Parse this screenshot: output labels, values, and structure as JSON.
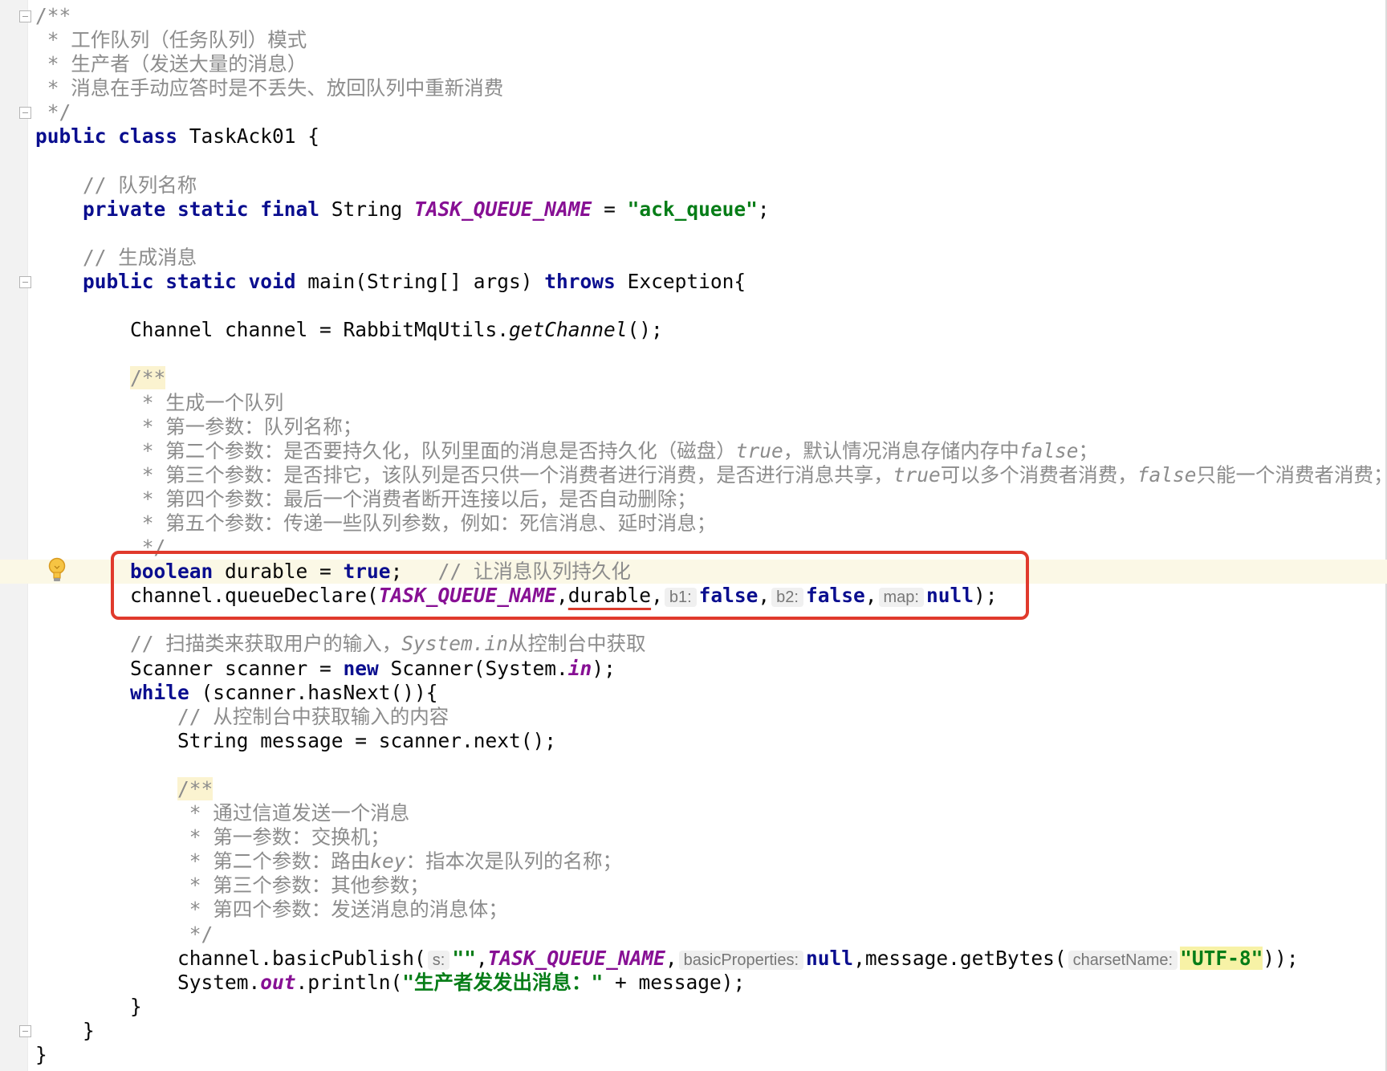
{
  "editor": {
    "file_class_name": "TaskAck01",
    "lines": [
      [
        {
          "t": "/**",
          "c": "doc"
        }
      ],
      [
        {
          "t": " * 工作队列（任务队列）模式",
          "c": "doc"
        }
      ],
      [
        {
          "t": " * 生产者（发送大量的消息）",
          "c": "doc"
        }
      ],
      [
        {
          "t": " * 消息在手动应答时是不丢失、放回队列中重新消费",
          "c": "doc"
        }
      ],
      [
        {
          "t": " */",
          "c": "doc"
        }
      ],
      [
        {
          "t": "public class",
          "c": "kw"
        },
        {
          "t": " TaskAck01 {",
          "c": ""
        }
      ],
      [],
      [
        {
          "t": "    "
        },
        {
          "t": "// 队列名称",
          "c": "cm"
        }
      ],
      [
        {
          "t": "    "
        },
        {
          "t": "private static final",
          "c": "kw"
        },
        {
          "t": " String "
        },
        {
          "t": "TASK_QUEUE_NAME",
          "c": "sf"
        },
        {
          "t": " = "
        },
        {
          "t": "\"ack_queue\"",
          "c": "str"
        },
        {
          "t": ";"
        }
      ],
      [],
      [
        {
          "t": "    "
        },
        {
          "t": "// 生成消息",
          "c": "cm"
        }
      ],
      [
        {
          "t": "    "
        },
        {
          "t": "public static void",
          "c": "kw"
        },
        {
          "t": " main(String[] args) "
        },
        {
          "t": "throws",
          "c": "kw"
        },
        {
          "t": " Exception{"
        }
      ],
      [],
      [
        {
          "t": "        Channel channel = RabbitMqUtils."
        },
        {
          "t": "getChannel",
          "c": "it"
        },
        {
          "t": "();"
        }
      ],
      [],
      [
        {
          "t": "        "
        },
        {
          "t": "/**",
          "c": "docstart"
        }
      ],
      [
        {
          "t": "         * 生成一个队列",
          "c": "doc"
        }
      ],
      [
        {
          "t": "         * 第一参数：队列名称；",
          "c": "doc"
        }
      ],
      [
        {
          "t": "         * 第二个参数：是否要持久化，队列里面的消息是否持久化（磁盘）",
          "c": "doc"
        },
        {
          "t": "true",
          "c": "docit"
        },
        {
          "t": "，默认情况消息存储内存中",
          "c": "doc"
        },
        {
          "t": "false",
          "c": "docit"
        },
        {
          "t": "；",
          "c": "doc"
        }
      ],
      [
        {
          "t": "         * 第三个参数：是否排它，该队列是否只供一个消费者进行消费，是否进行消息共享，",
          "c": "doc"
        },
        {
          "t": "true",
          "c": "docit"
        },
        {
          "t": "可以多个消费者消费，",
          "c": "doc"
        },
        {
          "t": "false",
          "c": "docit"
        },
        {
          "t": "只能一个消费者消费；",
          "c": "doc"
        }
      ],
      [
        {
          "t": "         * 第四个参数：最后一个消费者断开连接以后，是否自动删除；",
          "c": "doc"
        }
      ],
      [
        {
          "t": "         * 第五个参数：传递一些队列参数，例如：死信消息、延时消息；",
          "c": "doc"
        }
      ],
      [
        {
          "t": "         */",
          "c": "doc"
        }
      ],
      [
        {
          "t": "        "
        },
        {
          "t": "boolean",
          "c": "kw"
        },
        {
          "t": " durable = "
        },
        {
          "t": "true",
          "c": "kw"
        },
        {
          "t": ";   "
        },
        {
          "t": "// 让消息队列持久化",
          "c": "cm"
        }
      ],
      [
        {
          "t": "        channel.queueDeclare("
        },
        {
          "t": "TASK_QUEUE_NAME",
          "c": "sf"
        },
        {
          "t": ","
        },
        {
          "t": "durable",
          "c": "ul"
        },
        {
          "t": ","
        },
        {
          "t": "b1:",
          "c": "hint"
        },
        {
          "t": "false",
          "c": "kw"
        },
        {
          "t": ","
        },
        {
          "t": "b2:",
          "c": "hint"
        },
        {
          "t": "false",
          "c": "kw"
        },
        {
          "t": ","
        },
        {
          "t": "map:",
          "c": "hint"
        },
        {
          "t": "null",
          "c": "kw"
        },
        {
          "t": ");"
        }
      ],
      [],
      [
        {
          "t": "        "
        },
        {
          "t": "// 扫描类来获取用户的输入，",
          "c": "cm"
        },
        {
          "t": "System.in",
          "c": "docit"
        },
        {
          "t": "从控制台中获取",
          "c": "cm"
        }
      ],
      [
        {
          "t": "        Scanner scanner = "
        },
        {
          "t": "new",
          "c": "kw"
        },
        {
          "t": " Scanner(System."
        },
        {
          "t": "in",
          "c": "sf"
        },
        {
          "t": ");"
        }
      ],
      [
        {
          "t": "        "
        },
        {
          "t": "while",
          "c": "kw"
        },
        {
          "t": " (scanner.hasNext()){"
        }
      ],
      [
        {
          "t": "            "
        },
        {
          "t": "// 从控制台中获取输入的内容",
          "c": "cm"
        }
      ],
      [
        {
          "t": "            String message = scanner.next();"
        }
      ],
      [],
      [
        {
          "t": "            "
        },
        {
          "t": "/**",
          "c": "docstart"
        }
      ],
      [
        {
          "t": "             * 通过信道发送一个消息",
          "c": "doc"
        }
      ],
      [
        {
          "t": "             * 第一参数：交换机；",
          "c": "doc"
        }
      ],
      [
        {
          "t": "             * 第二个参数：路由",
          "c": "doc"
        },
        {
          "t": "key",
          "c": "docit"
        },
        {
          "t": "：指本次是队列的名称；",
          "c": "doc"
        }
      ],
      [
        {
          "t": "             * 第三个参数：其他参数；",
          "c": "doc"
        }
      ],
      [
        {
          "t": "             * 第四个参数：发送消息的消息体；",
          "c": "doc"
        }
      ],
      [
        {
          "t": "             */",
          "c": "doc"
        }
      ],
      [
        {
          "t": "            channel.basicPublish("
        },
        {
          "t": "s:",
          "c": "hint"
        },
        {
          "t": "\"\"",
          "c": "str"
        },
        {
          "t": ","
        },
        {
          "t": "TASK_QUEUE_NAME",
          "c": "sf"
        },
        {
          "t": ","
        },
        {
          "t": "basicProperties:",
          "c": "hint"
        },
        {
          "t": "null",
          "c": "kw"
        },
        {
          "t": ",message.getBytes("
        },
        {
          "t": "charsetName:",
          "c": "hint"
        },
        {
          "t": "\"UTF-8\"",
          "c": "strhl"
        },
        {
          "t": "));"
        }
      ],
      [
        {
          "t": "            System."
        },
        {
          "t": "out",
          "c": "sf"
        },
        {
          "t": ".println("
        },
        {
          "t": "\"生产者发发出消息：\"",
          "c": "str"
        },
        {
          "t": " + message);"
        }
      ],
      [
        {
          "t": "        }"
        }
      ],
      [
        {
          "t": "    }"
        }
      ],
      [
        {
          "t": "}"
        }
      ]
    ],
    "current_line": 23,
    "fold_markers": [
      0,
      4,
      11,
      42
    ]
  },
  "gutter_icons": {
    "intention": "lightbulb-icon"
  },
  "annotation": {
    "color": "#e03a2c",
    "lines": [
      23,
      24
    ]
  },
  "colors": {
    "keyword": "#0a0e8f",
    "comment": "#8c8c8c",
    "string": "#067d17",
    "static_field": "#871094",
    "current_line_bg": "#fbf8e6"
  }
}
